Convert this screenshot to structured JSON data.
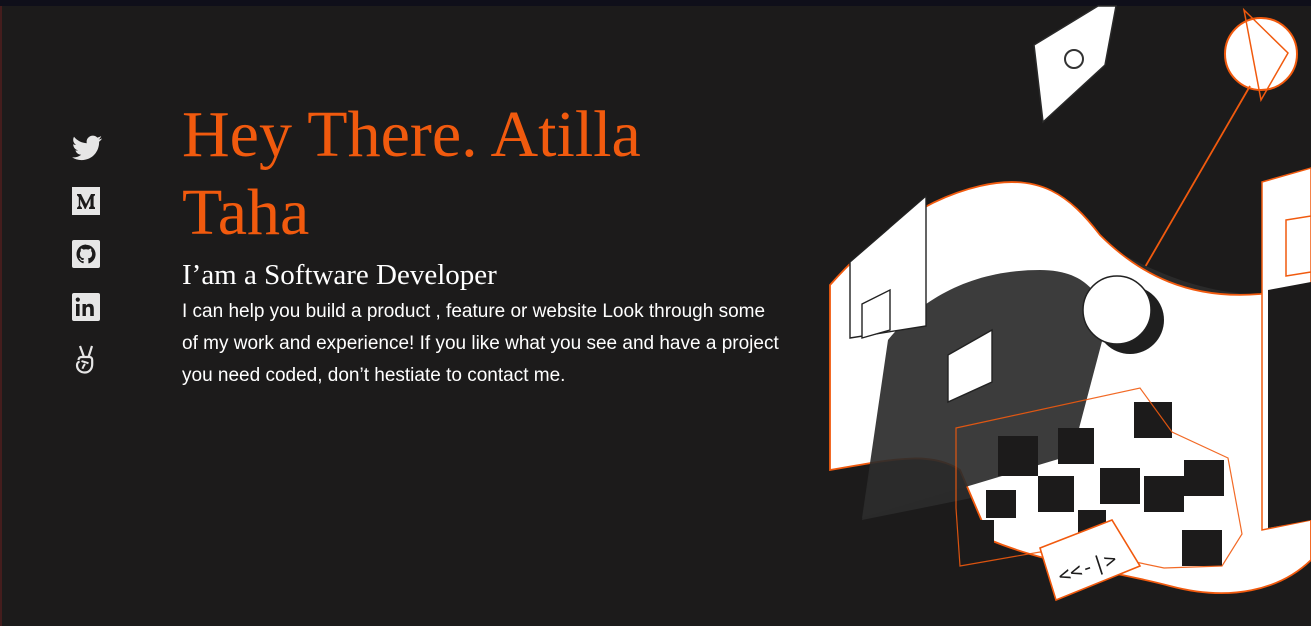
{
  "hero": {
    "greeting": "Hey There. Atilla Taha",
    "role": "I’am a Software Developer",
    "description": "I can help you build a product , feature or website Look through some of my work and experience! If you like what you see and have a project you need coded, don’t hestiate to contact me."
  },
  "social": [
    {
      "icon": "twitter-icon"
    },
    {
      "icon": "medium-icon"
    },
    {
      "icon": "github-icon"
    },
    {
      "icon": "linkedin-icon"
    },
    {
      "icon": "angellist-icon"
    }
  ],
  "illustration": {
    "code_tag": "<<-|>"
  },
  "colors": {
    "background": "#1c1b1b",
    "accent": "#f15a0e",
    "text": "#ffffff",
    "icon": "#e6e6e6"
  }
}
